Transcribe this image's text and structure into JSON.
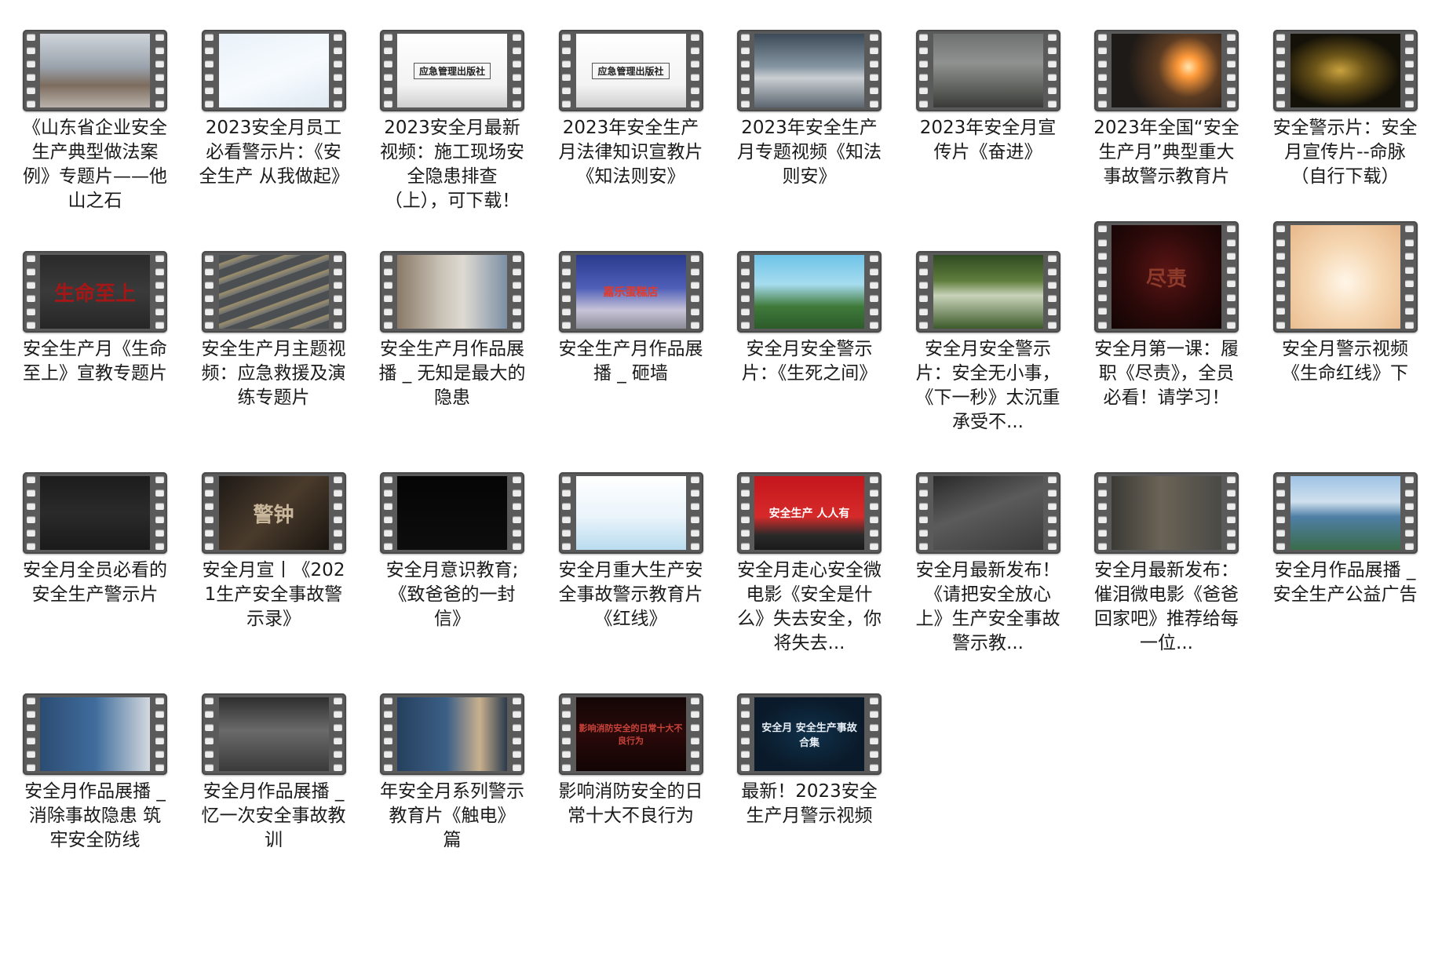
{
  "items": [
    {
      "title": "《山东省企业安全生产典型做法案例》专题片——他山之石",
      "shape": "wide",
      "bg": "linear-gradient(180deg,#cfd4da 0%,#9aa3ad 45%,#7d6c5e 70%,#b9b3ab 100%)",
      "overlay": "",
      "ovColor": "#c00"
    },
    {
      "title": "2023安全月员工必看警示片：《安全生产 从我做起》",
      "shape": "wide",
      "bg": "linear-gradient(160deg,#e9f1f8 0%,#f7fbff 55%,#dfe9f2 100%)",
      "overlay": "",
      "ovColor": "#333"
    },
    {
      "title": "2023安全月最新视频：施工现场安全隐患排查（上），可下载！",
      "shape": "wide",
      "bg": "linear-gradient(180deg,#ffffff 0%,#f3f3f3 70%,#cfcfcf 100%)",
      "overlay": "应急管理出版社",
      "ovColor": "#222"
    },
    {
      "title": "2023年安全生产月法律知识宣教片《知法则安》",
      "shape": "wide",
      "bg": "linear-gradient(180deg,#ffffff 0%,#f3f3f3 70%,#cfcfcf 100%)",
      "overlay": "应急管理出版社",
      "ovColor": "#222"
    },
    {
      "title": "2023年安全生产月专题视频《知法则安》",
      "shape": "wide",
      "bg": "linear-gradient(180deg,#3c4a58 0%,#8796a3 45%,#c9ced2 60%,#5c6670 100%)",
      "overlay": "",
      "ovColor": "#fff"
    },
    {
      "title": "2023年安全月宣传片《奋进》",
      "shape": "wide",
      "bg": "linear-gradient(180deg,#707272 0%,#8f9290 40%,#5e605c 75%,#3a3b38 100%)",
      "overlay": "",
      "ovColor": "#fff"
    },
    {
      "title": "2023年全国“安全生产月”典型重大事故警示教育片",
      "shape": "wide",
      "bg": "radial-gradient(circle at 70% 45%,#ffe6b0 0%,#ff9a3a 12%,#5b3b22 35%,#1e1a18 70%)",
      "overlay": "",
      "ovColor": "#fff"
    },
    {
      "title": "安全警示片：安全月宣传片--命脉（自行下载）",
      "shape": "wide",
      "bg": "radial-gradient(ellipse at 45% 50%,#c9a23e 0%,#6b5418 30%,#141108 70%)",
      "overlay": "",
      "ovColor": "#fff"
    },
    {
      "title": "安全生产月《生命至上》宣教专题片",
      "shape": "wide",
      "bg": "linear-gradient(180deg,#2a2a2a 0%,#3a3a3a 50%,#262626 100%)",
      "overlay": "生命至上",
      "ovColor": "#a51616"
    },
    {
      "title": "安全生产月主题视频：应急救援及演练专题片",
      "shape": "wide",
      "bg": "repeating-linear-gradient(160deg,#4c4f52 0px,#4c4f52 10px,#9c8f6c 11px,#6d6f70 18px)",
      "overlay": "",
      "ovColor": "#fff"
    },
    {
      "title": "安全生产月作品展播 _ 无知是最大的隐患",
      "shape": "wide",
      "bg": "linear-gradient(90deg,#8a7a68 0%,#c9c2b6 40%,#dedad3 60%,#7d8fa4 100%)",
      "overlay": "",
      "ovColor": "#fff"
    },
    {
      "title": "安全生产月作品展播 _ 砸墙",
      "shape": "wide",
      "bg": "linear-gradient(180deg,#2a3a8c 0%,#4f5fb8 45%,#c8c4d8 75%,#8c8c98 100%)",
      "overlay": "嘉乐蛋糕店",
      "ovColor": "#e23a2a"
    },
    {
      "title": "安全月安全警示片：《生死之间》",
      "shape": "wide",
      "bg": "linear-gradient(180deg,#6ec3e8 0%,#a6dcef 40%,#3f7a3a 70%,#2c5b2a 100%)",
      "overlay": "",
      "ovColor": "#fff"
    },
    {
      "title": "安全月安全警示片：安全无小事，《下一秒》太沉重承受不...",
      "shape": "wide",
      "bg": "linear-gradient(180deg,#2f4a22 0%,#5f7d3c 35%,#c8d3b9 55%,#3d5a2a 100%)",
      "overlay": "",
      "ovColor": "#fff"
    },
    {
      "title": "安全月第一课：履职《尽责》，全员必看！请学习！",
      "shape": "tall",
      "bg": "radial-gradient(ellipse at 50% 45%,#5a1414 0%,#2b0909 55%,#120404 100%)",
      "overlay": "尽责",
      "ovColor": "#8c3a2a"
    },
    {
      "title": "安全月警示视频《生命红线》下",
      "shape": "tall",
      "bg": "radial-gradient(ellipse at 50% 55%,#fff6e8 0%,#f6d8b4 45%,#e8b88a 100%)",
      "overlay": "",
      "ovColor": "#fff"
    },
    {
      "title": "安全月全员必看的安全生产警示片",
      "shape": "wide",
      "bg": "linear-gradient(180deg,#1c1c1c 0%,#2a2a2a 50%,#1a1a1a 100%)",
      "overlay": "",
      "ovColor": "#fff"
    },
    {
      "title": "安全月宣丨《2021生产安全事故警示录》",
      "shape": "wide",
      "bg": "linear-gradient(135deg,#1e1a16 0%,#4a3b2c 50%,#1a1510 100%)",
      "overlay": "警钟",
      "ovColor": "#c9b79c"
    },
    {
      "title": "安全月意识教育;《致爸爸的一封信》",
      "shape": "wide",
      "bg": "linear-gradient(180deg,#050505 0%,#0d0d0d 100%)",
      "overlay": "",
      "ovColor": "#ddd"
    },
    {
      "title": "安全月重大生产安全事故警示教育片《红线》",
      "shape": "wide",
      "bg": "linear-gradient(180deg,#ffffff 0%,#eaf4fb 55%,#b9dcef 100%)",
      "overlay": "",
      "ovColor": "#d22"
    },
    {
      "title": "安全月走心安全微电影《安全是什么》失去安全，你将失去...",
      "shape": "wide",
      "bg": "linear-gradient(180deg,#c4161c 0%,#d62a2a 55%,#2a2a2a 80%,#1a1a1a 100%)",
      "overlay": "安全生产 人人有",
      "ovColor": "#ffffff"
    },
    {
      "title": "安全月最新发布！《请把安全放心上》生产安全事故警示教...",
      "shape": "wide",
      "bg": "linear-gradient(160deg,#2a2a2a 0%,#5b5b5b 45%,#3a3a3a 100%)",
      "overlay": "",
      "ovColor": "#fff"
    },
    {
      "title": "安全月最新发布：催泪微电影《爸爸回家吧》推荐给每一位...",
      "shape": "wide",
      "bg": "linear-gradient(90deg,#3b3a36 0%,#6a6356 45%,#4a4a46 100%)",
      "overlay": "",
      "ovColor": "#fff"
    },
    {
      "title": "安全月作品展播 _ 安全生产公益广告",
      "shape": "wide",
      "bg": "linear-gradient(180deg,#9fc3e4 0%,#cfe0ee 35%,#4f7fa6 55%,#3a6c4a 100%)",
      "overlay": "",
      "ovColor": "#fff"
    },
    {
      "title": "安全月作品展播 _ 消除事故隐患 筑牢安全防线",
      "shape": "wide",
      "bg": "linear-gradient(90deg,#2c4c72 0%,#3f6c9c 50%,#d3d9df 100%)",
      "overlay": "",
      "ovColor": "#fff"
    },
    {
      "title": "安全月作品展播 _ 忆一次安全事故教训",
      "shape": "wide",
      "bg": "linear-gradient(180deg,#2e2e2e 0%,#6a6a6a 45%,#3a3a3a 100%)",
      "overlay": "",
      "ovColor": "#fff"
    },
    {
      "title": "年安全月系列警示教育片《触电》 篇",
      "shape": "wide",
      "bg": "linear-gradient(90deg,#25405e 0%,#3c5f86 45%,#c9b08e 75%,#2a3a4c 100%)",
      "overlay": "",
      "ovColor": "#fff"
    },
    {
      "title": "影响消防安全的日常十大不良行为",
      "shape": "wide",
      "bg": "linear-gradient(180deg,#140606 0%,#2a0909 50%,#120404 100%)",
      "overlay": "影响消防安全的日常十大不良行为",
      "ovColor": "#c9433a"
    },
    {
      "title": "最新！2023安全生产月警示视频",
      "shape": "wide",
      "bg": "radial-gradient(ellipse at 50% 50%,#10314a 0%,#0a1a2a 70%)",
      "overlay": "安全月 安全生产事故合集",
      "ovColor": "#e8eef5"
    }
  ]
}
